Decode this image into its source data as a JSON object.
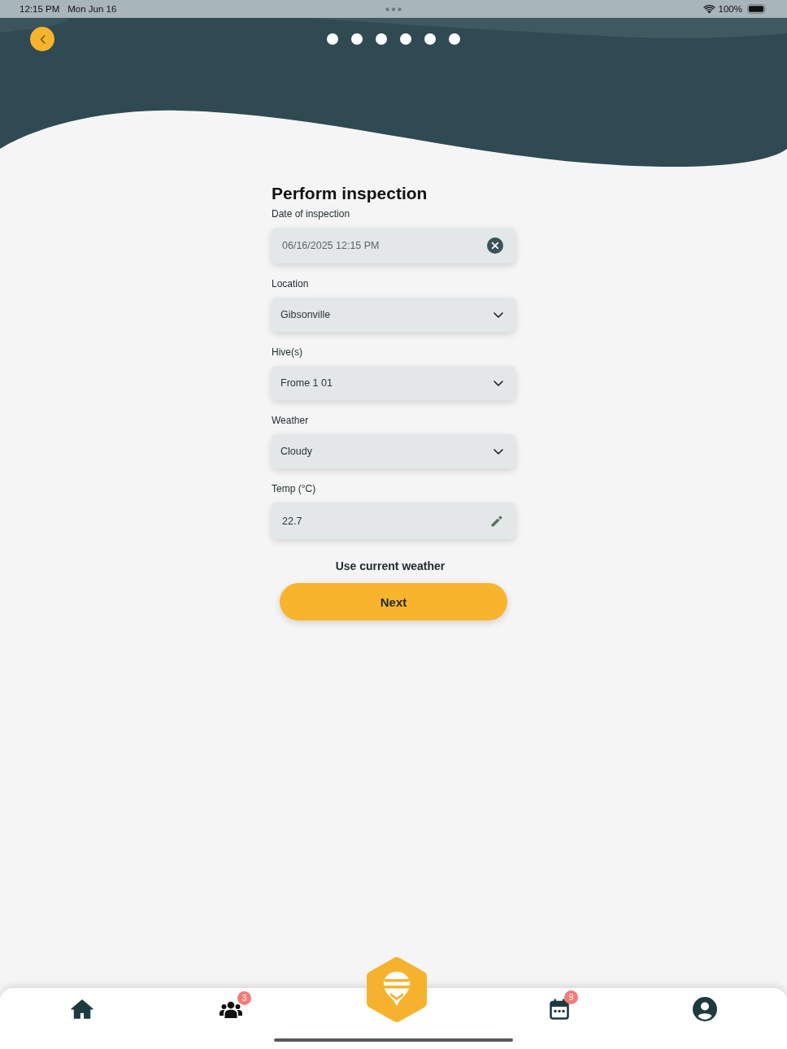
{
  "status_bar": {
    "time": "12:15 PM",
    "date": "Mon Jun 16",
    "battery": "100%"
  },
  "form": {
    "title": "Perform inspection",
    "fields": [
      {
        "kind": "date",
        "label": "Date of inspection",
        "value": "06/16/2025 12:15 PM"
      },
      {
        "kind": "dropdown",
        "label": "Location",
        "value": "Gibsonville"
      },
      {
        "kind": "dropdown",
        "label": "Hive(s)",
        "value": "Frome 1 01"
      },
      {
        "kind": "dropdown",
        "label": "Weather",
        "value": "Cloudy"
      },
      {
        "kind": "number",
        "label": "Temp (°C)",
        "value": "22.7"
      }
    ],
    "link": "Use current weather",
    "button": "Next"
  },
  "nav": {
    "items": [
      {
        "kind": "home"
      },
      {
        "kind": "people",
        "badge": "3"
      },
      {
        "kind": "hive"
      },
      {
        "kind": "calendar",
        "badge": "9"
      },
      {
        "kind": "profile"
      }
    ]
  }
}
